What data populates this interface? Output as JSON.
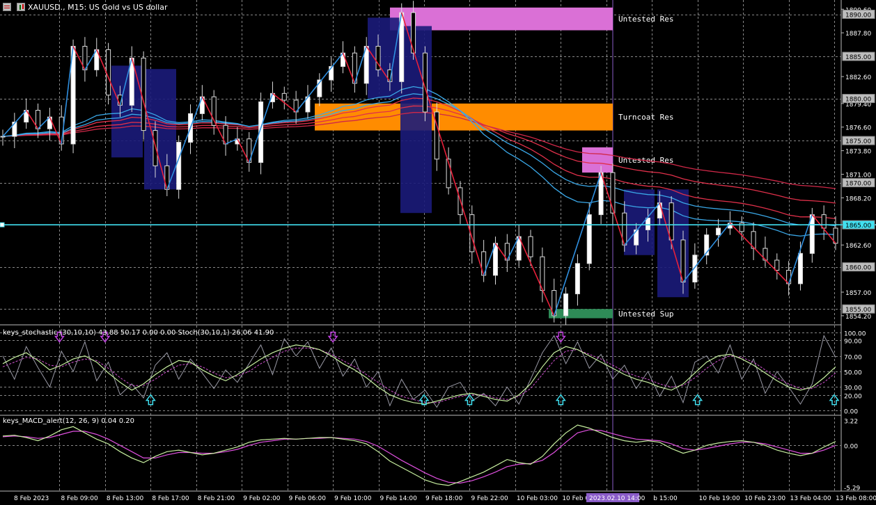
{
  "window": {
    "title": "XAUUSD., M15:  US Gold vs US dollar"
  },
  "indicators": {
    "stochastic_label": "keys_stochastic (30,10,10) 43.88 50.17 0.00 0.00 Stoch(30,10,1) 26.06 41.90",
    "macd_label": "keys_MACD_alert(12, 26, 9) 0.04 0.20"
  },
  "zones": [
    {
      "name": "untested-res-top",
      "label": "Untested Res",
      "color": "#da70d6"
    },
    {
      "name": "turncoat-res",
      "label": "Turncoat Res",
      "color": "#ff8c00"
    },
    {
      "name": "untested-res-mid",
      "label": "Untested Res",
      "color": "#da70d6"
    },
    {
      "name": "untested-sup",
      "label": "Untested Sup",
      "color": "#2e8b57"
    }
  ],
  "chart_data": [
    {
      "type": "candlestick",
      "symbol": "XAUUSD.",
      "timeframe": "M15",
      "price_ticks": [
        "1890.60",
        "1887.80",
        "1882.60",
        "1879.40",
        "1876.60",
        "1873.80",
        "1871.00",
        "1868.20",
        "1862.60",
        "1857.00",
        "1854.20"
      ],
      "price_boxes": [
        "1890.00",
        "1885.00",
        "1880.00",
        "1875.00",
        "1870.00",
        "1865.00",
        "1860.00",
        "1855.00"
      ],
      "ylim": [
        1853.2,
        1891.2
      ],
      "time_labels": [
        "8 Feb 2023",
        "8 Feb 09:00",
        "8 Feb 13:00",
        "8 Feb 17:00",
        "8 Feb 21:00",
        "9 Feb 02:00",
        "9 Feb 06:00",
        "9 Feb 10:00",
        "9 Feb 14:00",
        "9 Feb 18:00",
        "9 Feb 22:00",
        "10 Feb 03:00",
        "10 Feb 07:00",
        "2023.02.10 14:00",
        "b 15:00",
        "10 Feb 19:00",
        "10 Feb 23:00",
        "13 Feb 04:00",
        "13 Feb 08:00"
      ],
      "horizontal_line": 1865.0,
      "close_path": [
        1875.5,
        1877.2,
        1878.6,
        1876.4,
        1877.8,
        1874.6,
        1886.2,
        1883.4,
        1885.8,
        1880.4,
        1879.2,
        1884.8,
        1876.2,
        1872.0,
        1869.2,
        1874.8,
        1878.2,
        1880.2,
        1876.8,
        1874.6,
        1875.2,
        1872.4,
        1879.6,
        1880.6,
        1879.8,
        1878.4,
        1880.2,
        1882.2,
        1883.8,
        1885.4,
        1881.8,
        1886.2,
        1883.4,
        1882.0,
        1890.2,
        1885.4,
        1878.4,
        1872.8,
        1869.4,
        1866.2,
        1861.8,
        1859.0,
        1862.8,
        1860.8,
        1863.6,
        1861.2,
        1857.2,
        1854.2,
        1856.8,
        1860.4,
        1866.2,
        1871.2,
        1866.4,
        1862.6,
        1864.4,
        1865.8,
        1867.6,
        1863.2,
        1858.2,
        1861.4,
        1863.8,
        1864.6,
        1865.2,
        1864.2,
        1862.2,
        1860.8,
        1859.6,
        1858.0,
        1861.6,
        1866.2,
        1864.6,
        1862.8
      ]
    },
    {
      "type": "line",
      "name": "keys_stochastic",
      "ylim": [
        0,
        100
      ],
      "ticks": [
        "100.00",
        "90.00",
        "70.00",
        "50.00",
        "30.00",
        "20.00",
        "0.00"
      ],
      "main_line": [
        60,
        68,
        74,
        64,
        52,
        58,
        66,
        70,
        62,
        48,
        36,
        26,
        34,
        46,
        56,
        64,
        62,
        52,
        44,
        38,
        46,
        56,
        66,
        74,
        80,
        84,
        82,
        78,
        70,
        60,
        52,
        42,
        30,
        20,
        14,
        10,
        8,
        12,
        16,
        20,
        22,
        18,
        14,
        12,
        20,
        34,
        56,
        74,
        82,
        78,
        70,
        62,
        54,
        46,
        40,
        36,
        30,
        26,
        34,
        48,
        62,
        70,
        72,
        66,
        58,
        48,
        38,
        30,
        26,
        30,
        42,
        56
      ],
      "signal_line": [
        56,
        62,
        68,
        66,
        58,
        56,
        62,
        66,
        64,
        54,
        42,
        32,
        32,
        40,
        50,
        58,
        60,
        56,
        48,
        42,
        44,
        50,
        60,
        68,
        76,
        80,
        80,
        78,
        72,
        64,
        56,
        46,
        36,
        26,
        18,
        14,
        10,
        10,
        14,
        18,
        20,
        20,
        16,
        14,
        18,
        28,
        46,
        64,
        76,
        78,
        72,
        66,
        58,
        50,
        44,
        40,
        34,
        30,
        32,
        42,
        54,
        64,
        70,
        68,
        62,
        52,
        42,
        34,
        28,
        28,
        36,
        48
      ],
      "raw_line": [
        70,
        40,
        82,
        55,
        30,
        76,
        50,
        88,
        38,
        62,
        20,
        34,
        16,
        58,
        74,
        40,
        66,
        48,
        28,
        52,
        36,
        60,
        84,
        46,
        92,
        70,
        88,
        54,
        80,
        44,
        66,
        30,
        50,
        6,
        40,
        14,
        26,
        4,
        30,
        36,
        12,
        22,
        6,
        30,
        8,
        40,
        74,
        96,
        60,
        88,
        54,
        72,
        40,
        58,
        28,
        50,
        18,
        44,
        10,
        62,
        70,
        48,
        84,
        40,
        66,
        22,
        50,
        30,
        8,
        34,
        96,
        68
      ],
      "markers_down": [
        "8 Feb 09:00",
        "8 Feb 13:00",
        "9 Feb 10:00",
        "10 Feb 07:00"
      ],
      "markers_up": [
        "8 Feb 17:00",
        "9 Feb 18:00",
        "9 Feb 22:00",
        "10 Feb 07:00",
        "10 Feb 19:00",
        "13 Feb 08:00"
      ]
    },
    {
      "type": "line",
      "name": "keys_MACD_alert",
      "ylim": [
        -5.29,
        3.22
      ],
      "ticks": [
        "3.22",
        "0.00",
        "-5.29"
      ],
      "macd_line": [
        1.2,
        1.3,
        1.0,
        0.6,
        1.2,
        2.0,
        2.4,
        1.6,
        0.8,
        0.2,
        -0.8,
        -1.6,
        -2.2,
        -1.4,
        -0.8,
        -0.6,
        -0.9,
        -1.2,
        -1.0,
        -0.6,
        -0.2,
        0.4,
        0.7,
        0.8,
        0.9,
        0.8,
        0.9,
        1.0,
        1.0,
        0.8,
        0.6,
        0.2,
        -0.8,
        -2.0,
        -2.8,
        -3.6,
        -4.4,
        -4.9,
        -5.1,
        -4.6,
        -4.0,
        -3.4,
        -2.6,
        -1.8,
        -2.2,
        -2.4,
        -1.4,
        0.2,
        1.6,
        2.6,
        2.2,
        1.6,
        1.0,
        0.6,
        0.4,
        0.6,
        0.4,
        -0.4,
        -1.0,
        -0.6,
        0.0,
        0.3,
        0.5,
        0.6,
        0.4,
        0.0,
        -0.6,
        -1.0,
        -1.3,
        -1.0,
        -0.2,
        0.5
      ],
      "signal_line": [
        1.1,
        1.2,
        1.1,
        0.9,
        1.0,
        1.4,
        1.8,
        1.8,
        1.4,
        0.8,
        0.0,
        -0.8,
        -1.6,
        -1.6,
        -1.2,
        -0.9,
        -0.9,
        -1.0,
        -1.0,
        -0.8,
        -0.5,
        0.0,
        0.4,
        0.6,
        0.8,
        0.8,
        0.9,
        0.9,
        1.0,
        0.9,
        0.8,
        0.5,
        -0.1,
        -1.0,
        -1.9,
        -2.7,
        -3.5,
        -4.2,
        -4.7,
        -4.8,
        -4.5,
        -4.0,
        -3.4,
        -2.7,
        -2.4,
        -2.3,
        -1.9,
        -0.9,
        0.4,
        1.6,
        2.0,
        1.9,
        1.5,
        1.1,
        0.8,
        0.7,
        0.6,
        0.2,
        -0.4,
        -0.6,
        -0.4,
        -0.1,
        0.2,
        0.4,
        0.4,
        0.2,
        -0.2,
        -0.6,
        -1.0,
        -1.0,
        -0.6,
        0.0
      ]
    }
  ]
}
